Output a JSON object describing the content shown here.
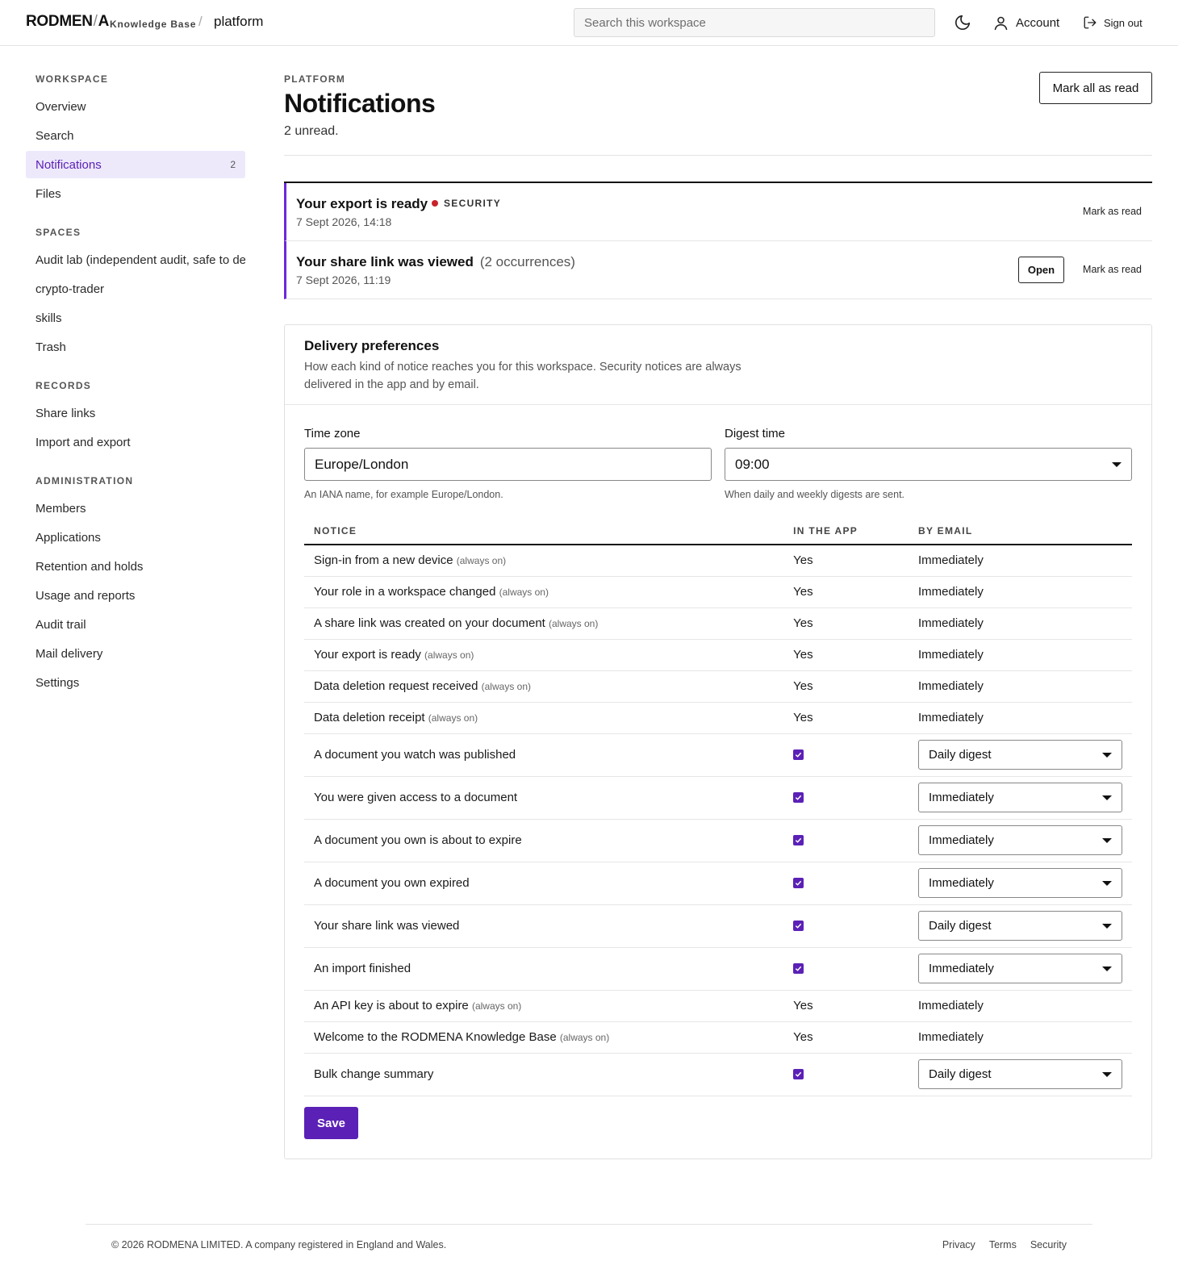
{
  "header": {
    "brand": "RODMEN",
    "brand_slash": "/",
    "brand_end": "A",
    "brand_sub": "Knowledge Base",
    "crumb_sep": "/",
    "crumb": "platform",
    "search_placeholder": "Search this workspace",
    "account_label": "Account",
    "signout_label": "Sign out",
    "icons": {
      "theme": "moon-icon",
      "account": "user-icon",
      "signout": "sign-out-icon"
    }
  },
  "sidebar": {
    "groups": [
      {
        "title": "WORKSPACE",
        "items": [
          {
            "label": "Overview"
          },
          {
            "label": "Search"
          },
          {
            "label": "Notifications",
            "badge": "2",
            "active": true
          },
          {
            "label": "Files"
          }
        ]
      },
      {
        "title": "SPACES",
        "items": [
          {
            "label": "Audit lab (independent audit, safe to de"
          },
          {
            "label": "crypto-trader"
          },
          {
            "label": "skills"
          },
          {
            "label": "Trash"
          }
        ]
      },
      {
        "title": "RECORDS",
        "items": [
          {
            "label": "Share links"
          },
          {
            "label": "Import and export"
          }
        ]
      },
      {
        "title": "ADMINISTRATION",
        "items": [
          {
            "label": "Members"
          },
          {
            "label": "Applications"
          },
          {
            "label": "Retention and holds"
          },
          {
            "label": "Usage and reports"
          },
          {
            "label": "Audit trail"
          },
          {
            "label": "Mail delivery"
          },
          {
            "label": "Settings"
          }
        ]
      }
    ]
  },
  "main": {
    "eyebrow": "PLATFORM",
    "title": "Notifications",
    "unread": "2 unread.",
    "mark_all": "Mark all as read",
    "notifications": [
      {
        "title": "Your export is ready",
        "tag": "SECURITY",
        "date": "7 Sept 2026, 14:18",
        "mark": "Mark as read"
      },
      {
        "title": "Your share link was viewed",
        "occurrences": "(2 occurrences)",
        "date": "7 Sept 2026, 11:19",
        "open": "Open",
        "mark": "Mark as read"
      }
    ]
  },
  "prefs": {
    "title": "Delivery preferences",
    "description": "How each kind of notice reaches you for this workspace. Security notices are always delivered in the app and by email.",
    "timezone_label": "Time zone",
    "timezone_value": "Europe/London",
    "timezone_hint": "An IANA name, for example Europe/London.",
    "digest_label": "Digest time",
    "digest_value": "09:00",
    "digest_hint": "When daily and weekly digests are sent.",
    "columns": [
      "NOTICE",
      "IN THE APP",
      "BY EMAIL"
    ],
    "rows": [
      {
        "notice": "Sign-in from a new device",
        "always": "(always on)",
        "app": "Yes",
        "email": "Immediately"
      },
      {
        "notice": "Your role in a workspace changed",
        "always": "(always on)",
        "app": "Yes",
        "email": "Immediately"
      },
      {
        "notice": "A share link was created on your document",
        "always": "(always on)",
        "app": "Yes",
        "email": "Immediately"
      },
      {
        "notice": "Your export is ready",
        "always": "(always on)",
        "app": "Yes",
        "email": "Immediately"
      },
      {
        "notice": "Data deletion request received",
        "always": "(always on)",
        "app": "Yes",
        "email": "Immediately"
      },
      {
        "notice": "Data deletion receipt",
        "always": "(always on)",
        "app": "Yes",
        "email": "Immediately"
      },
      {
        "notice": "A document you watch was published",
        "checked": true,
        "email": "Daily digest"
      },
      {
        "notice": "You were given access to a document",
        "checked": true,
        "email": "Immediately"
      },
      {
        "notice": "A document you own is about to expire",
        "checked": true,
        "email": "Immediately"
      },
      {
        "notice": "A document you own expired",
        "checked": true,
        "email": "Immediately"
      },
      {
        "notice": "Your share link was viewed",
        "checked": true,
        "email": "Daily digest"
      },
      {
        "notice": "An import finished",
        "checked": true,
        "email": "Immediately"
      },
      {
        "notice": "An API key is about to expire",
        "always": "(always on)",
        "app": "Yes",
        "email": "Immediately"
      },
      {
        "notice": "Welcome to the RODMENA Knowledge Base",
        "always": "(always on)",
        "app": "Yes",
        "email": "Immediately"
      },
      {
        "notice": "Bulk change summary",
        "checked": true,
        "email": "Daily digest"
      }
    ],
    "save": "Save"
  },
  "footer": {
    "copyright": "© 2026 RODMENA LIMITED. A company registered in England and Wales.",
    "links": [
      "Privacy",
      "Terms",
      "Security"
    ]
  },
  "colors": {
    "accent": "#5b21b6",
    "active_bg": "#ede9fb",
    "security_dot": "#c8232c"
  }
}
